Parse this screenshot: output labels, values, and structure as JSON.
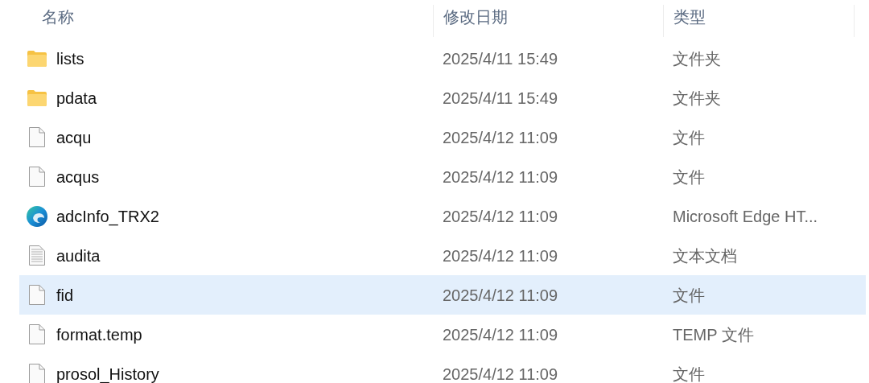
{
  "columns": [
    "名称",
    "修改日期",
    "类型"
  ],
  "rows": [
    {
      "kind": "folder",
      "name": "lists",
      "modified": "2025/4/11 15:49",
      "type": "文件夹",
      "selected": false
    },
    {
      "kind": "folder",
      "name": "pdata",
      "modified": "2025/4/11 15:49",
      "type": "文件夹",
      "selected": false
    },
    {
      "kind": "file",
      "name": "acqu",
      "modified": "2025/4/12 11:09",
      "type": "文件",
      "selected": false
    },
    {
      "kind": "file",
      "name": "acqus",
      "modified": "2025/4/12 11:09",
      "type": "文件",
      "selected": false
    },
    {
      "kind": "browser",
      "name": "adcInfo_TRX2",
      "modified": "2025/4/12 11:09",
      "type": "Microsoft Edge HT...",
      "selected": false
    },
    {
      "kind": "text",
      "name": "audita",
      "modified": "2025/4/12 11:09",
      "type": "文本文档",
      "selected": false
    },
    {
      "kind": "file",
      "name": "fid",
      "modified": "2025/4/12 11:09",
      "type": "文件",
      "selected": true
    },
    {
      "kind": "file",
      "name": "format.temp",
      "modified": "2025/4/12 11:09",
      "type": "TEMP 文件",
      "selected": false
    },
    {
      "kind": "file",
      "name": "prosol_History",
      "modified": "2025/4/12 11:09",
      "type": "文件",
      "selected": false
    }
  ]
}
